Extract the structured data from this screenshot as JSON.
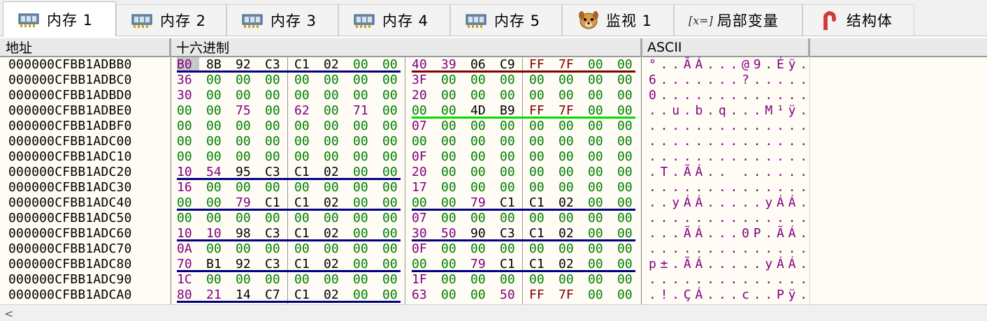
{
  "tabs": [
    {
      "label": "内存 1",
      "icon": "memory-chip-icon",
      "active": true
    },
    {
      "label": "内存 2",
      "icon": "memory-chip-icon",
      "active": false
    },
    {
      "label": "内存 3",
      "icon": "memory-chip-icon",
      "active": false
    },
    {
      "label": "内存 4",
      "icon": "memory-chip-icon",
      "active": false
    },
    {
      "label": "内存 5",
      "icon": "memory-chip-icon",
      "active": false
    },
    {
      "label": "监视 1",
      "icon": "dog-face-icon",
      "active": false
    },
    {
      "label": "局部变量",
      "prefix": "[x=]",
      "icon": "variable-icon",
      "active": false
    },
    {
      "label": "结构体",
      "icon": "candy-cane-icon",
      "active": false
    }
  ],
  "columns": {
    "address": "地址",
    "hex": "十六进制",
    "ascii": "ASCII"
  },
  "colors": {
    "zero": "#008000",
    "nonzero": "#800080",
    "underline_blue": "#000080",
    "underline_red": "#800000",
    "underline_green": "#00dd00",
    "selection": "#c8c8c8"
  },
  "rows": [
    {
      "addr": "000000CFBB1ADBB0",
      "bytes": [
        "B0",
        "8B",
        "92",
        "C3",
        "C1",
        "02",
        "00",
        "00",
        "40",
        "39",
        "06",
        "C9",
        "FF",
        "7F",
        "00",
        "00"
      ],
      "ascii": "°..ÃÁ...@9.Éÿ..."
    },
    {
      "addr": "000000CFBB1ADBC0",
      "bytes": [
        "36",
        "00",
        "00",
        "00",
        "00",
        "00",
        "00",
        "00",
        "3F",
        "00",
        "00",
        "00",
        "00",
        "00",
        "00",
        "00"
      ],
      "ascii": "6.......?......."
    },
    {
      "addr": "000000CFBB1ADBD0",
      "bytes": [
        "30",
        "00",
        "00",
        "00",
        "00",
        "00",
        "00",
        "00",
        "20",
        "00",
        "00",
        "00",
        "00",
        "00",
        "00",
        "00"
      ],
      "ascii": "0..............."
    },
    {
      "addr": "000000CFBB1ADBE0",
      "bytes": [
        "00",
        "00",
        "75",
        "00",
        "62",
        "00",
        "71",
        "00",
        "00",
        "00",
        "4D",
        "B9",
        "FF",
        "7F",
        "00",
        "00"
      ],
      "ascii": "..u.b.q...M¹ÿ..."
    },
    {
      "addr": "000000CFBB1ADBF0",
      "bytes": [
        "00",
        "00",
        "00",
        "00",
        "00",
        "00",
        "00",
        "00",
        "07",
        "00",
        "00",
        "00",
        "00",
        "00",
        "00",
        "00"
      ],
      "ascii": "................"
    },
    {
      "addr": "000000CFBB1ADC00",
      "bytes": [
        "00",
        "00",
        "00",
        "00",
        "00",
        "00",
        "00",
        "00",
        "00",
        "00",
        "00",
        "00",
        "00",
        "00",
        "00",
        "00"
      ],
      "ascii": "................"
    },
    {
      "addr": "000000CFBB1ADC10",
      "bytes": [
        "00",
        "00",
        "00",
        "00",
        "00",
        "00",
        "00",
        "00",
        "0F",
        "00",
        "00",
        "00",
        "00",
        "00",
        "00",
        "00"
      ],
      "ascii": "................"
    },
    {
      "addr": "000000CFBB1ADC20",
      "bytes": [
        "10",
        "54",
        "95",
        "C3",
        "C1",
        "02",
        "00",
        "00",
        "20",
        "00",
        "00",
        "00",
        "00",
        "00",
        "00",
        "00"
      ],
      "ascii": ".T.ÃÁ.. ......."
    },
    {
      "addr": "000000CFBB1ADC30",
      "bytes": [
        "16",
        "00",
        "00",
        "00",
        "00",
        "00",
        "00",
        "00",
        "17",
        "00",
        "00",
        "00",
        "00",
        "00",
        "00",
        "00"
      ],
      "ascii": "................"
    },
    {
      "addr": "000000CFBB1ADC40",
      "bytes": [
        "00",
        "00",
        "79",
        "C1",
        "C1",
        "02",
        "00",
        "00",
        "00",
        "00",
        "79",
        "C1",
        "C1",
        "02",
        "00",
        "00"
      ],
      "ascii": "..yÁÁ.....yÁÁ..."
    },
    {
      "addr": "000000CFBB1ADC50",
      "bytes": [
        "00",
        "00",
        "00",
        "00",
        "00",
        "00",
        "00",
        "00",
        "07",
        "00",
        "00",
        "00",
        "00",
        "00",
        "00",
        "00"
      ],
      "ascii": "................"
    },
    {
      "addr": "000000CFBB1ADC60",
      "bytes": [
        "10",
        "10",
        "98",
        "C3",
        "C1",
        "02",
        "00",
        "00",
        "30",
        "50",
        "90",
        "C3",
        "C1",
        "02",
        "00",
        "00"
      ],
      "ascii": "...ÃÁ...0P.ÃÁ.."
    },
    {
      "addr": "000000CFBB1ADC70",
      "bytes": [
        "0A",
        "00",
        "00",
        "00",
        "00",
        "00",
        "00",
        "00",
        "0F",
        "00",
        "00",
        "00",
        "00",
        "00",
        "00",
        "00"
      ],
      "ascii": "................"
    },
    {
      "addr": "000000CFBB1ADC80",
      "bytes": [
        "70",
        "B1",
        "92",
        "C3",
        "C1",
        "02",
        "00",
        "00",
        "00",
        "00",
        "79",
        "C1",
        "C1",
        "02",
        "00",
        "00"
      ],
      "ascii": "p±.ÃÁ.....yÁÁ..."
    },
    {
      "addr": "000000CFBB1ADC90",
      "bytes": [
        "1C",
        "00",
        "00",
        "00",
        "00",
        "00",
        "00",
        "00",
        "1F",
        "00",
        "00",
        "00",
        "00",
        "00",
        "00",
        "00"
      ],
      "ascii": "................"
    },
    {
      "addr": "000000CFBB1ADCA0",
      "bytes": [
        "80",
        "21",
        "14",
        "C7",
        "C1",
        "02",
        "00",
        "00",
        "63",
        "00",
        "00",
        "50",
        "FF",
        "7F",
        "00",
        "00"
      ],
      "ascii": ".!.ÇÁ...c..Pÿ..."
    }
  ],
  "scroll": {
    "left_arrow": "<"
  }
}
